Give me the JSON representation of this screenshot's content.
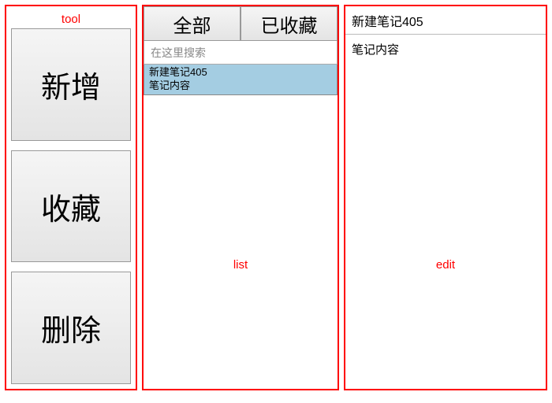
{
  "tool": {
    "label": "tool",
    "buttons": {
      "add": "新增",
      "fav": "收藏",
      "del": "删除"
    }
  },
  "list": {
    "label": "list",
    "tabs": {
      "all": "全部",
      "favorited": "已收藏"
    },
    "search_placeholder": "在这里搜索",
    "items": [
      {
        "title": "新建笔记405",
        "body": "笔记内容"
      }
    ]
  },
  "edit": {
    "label": "edit",
    "title": "新建笔记405",
    "body": "笔记内容"
  }
}
